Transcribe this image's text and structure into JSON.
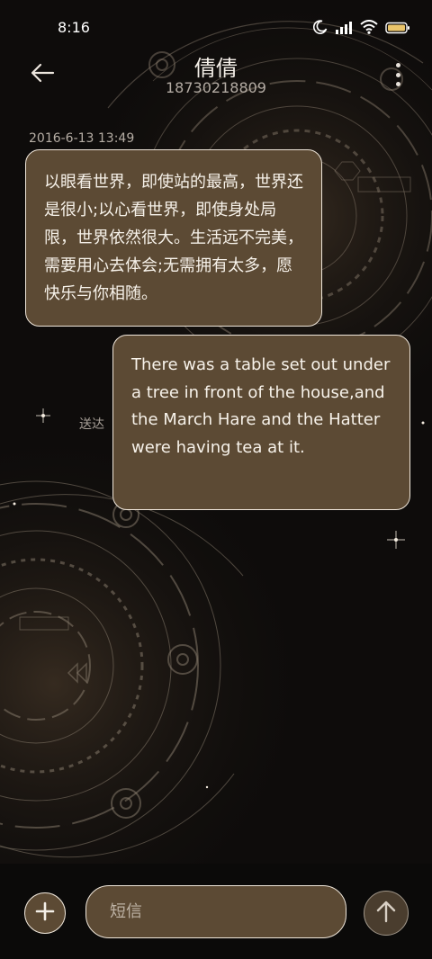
{
  "status_bar": {
    "time": "8:16",
    "icons": [
      "moon-icon",
      "signal-icon",
      "wifi-icon",
      "battery-icon"
    ]
  },
  "header": {
    "back_icon": "arrow-left-icon",
    "contact_name": "倩倩",
    "contact_number": "18730218809",
    "more_icon": "more-vertical-icon"
  },
  "conversation": {
    "timestamp": "2016-6-13 13:49",
    "messages": [
      {
        "direction": "incoming",
        "text": "以眼看世界，即使站的最高，世界还是很小;以心看世界，即使身处局限，世界依然很大。生活远不完美，需要用心去体会;无需拥有太多，愿快乐与你相随。"
      },
      {
        "direction": "outgoing",
        "text": "There was a table set out under a tree in front of the house,and the March Hare and the Hatter were having tea at it.",
        "status": "送达"
      }
    ]
  },
  "composer": {
    "add_icon": "plus-icon",
    "placeholder": "短信",
    "value": "",
    "send_icon": "arrow-up-icon"
  },
  "colors": {
    "background": "#0d0b0a",
    "bubble_fill": "#5c4a34",
    "bubble_border": "#efe6da",
    "accent_text": "#f7f2ea"
  }
}
